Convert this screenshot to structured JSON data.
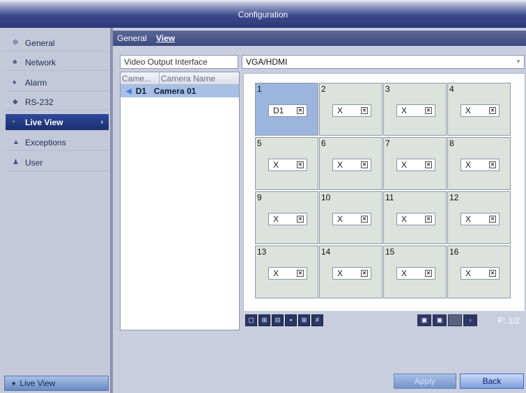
{
  "window": {
    "title": "Configuration"
  },
  "sidebar": {
    "items": [
      {
        "label": "General",
        "icon": "gear-icon"
      },
      {
        "label": "Network",
        "icon": "network-icon"
      },
      {
        "label": "Alarm",
        "icon": "alarm-icon"
      },
      {
        "label": "RS-232",
        "icon": "serial-port-icon"
      },
      {
        "label": "Live View",
        "icon": "live-view-icon",
        "active": true,
        "chevron": "›"
      },
      {
        "label": "Exceptions",
        "icon": "warning-icon"
      },
      {
        "label": "User",
        "icon": "user-icon"
      }
    ],
    "bottom_button": "Live View"
  },
  "tabs": [
    {
      "label": "General"
    },
    {
      "label": "View",
      "selected": true
    }
  ],
  "video_output": {
    "label": "Video Output Interface",
    "value": "VGA/HDMI"
  },
  "camera_list": {
    "headers": [
      "Came...",
      "Camera Name"
    ],
    "rows": [
      {
        "id": "D1",
        "name": "Camera 01"
      }
    ]
  },
  "windows": [
    {
      "num": "1",
      "camera": "D1"
    },
    {
      "num": "2",
      "camera": "X"
    },
    {
      "num": "3",
      "camera": "X"
    },
    {
      "num": "4",
      "camera": "X"
    },
    {
      "num": "5",
      "camera": "X"
    },
    {
      "num": "6",
      "camera": "X"
    },
    {
      "num": "7",
      "camera": "X"
    },
    {
      "num": "8",
      "camera": "X"
    },
    {
      "num": "9",
      "camera": "X"
    },
    {
      "num": "10",
      "camera": "X"
    },
    {
      "num": "11",
      "camera": "X"
    },
    {
      "num": "12",
      "camera": "X"
    },
    {
      "num": "13",
      "camera": "X"
    },
    {
      "num": "14",
      "camera": "X"
    },
    {
      "num": "15",
      "camera": "X"
    },
    {
      "num": "16",
      "camera": "X"
    }
  ],
  "pagination": {
    "indicator": "P: 1/2"
  },
  "buttons": {
    "apply": "Apply",
    "back": "Back"
  },
  "colors": {
    "title_bar": "#2a3777",
    "active_nav": "#1b2f70",
    "selected_window": "#9bb5de",
    "window_bg": "#dde2dd"
  }
}
